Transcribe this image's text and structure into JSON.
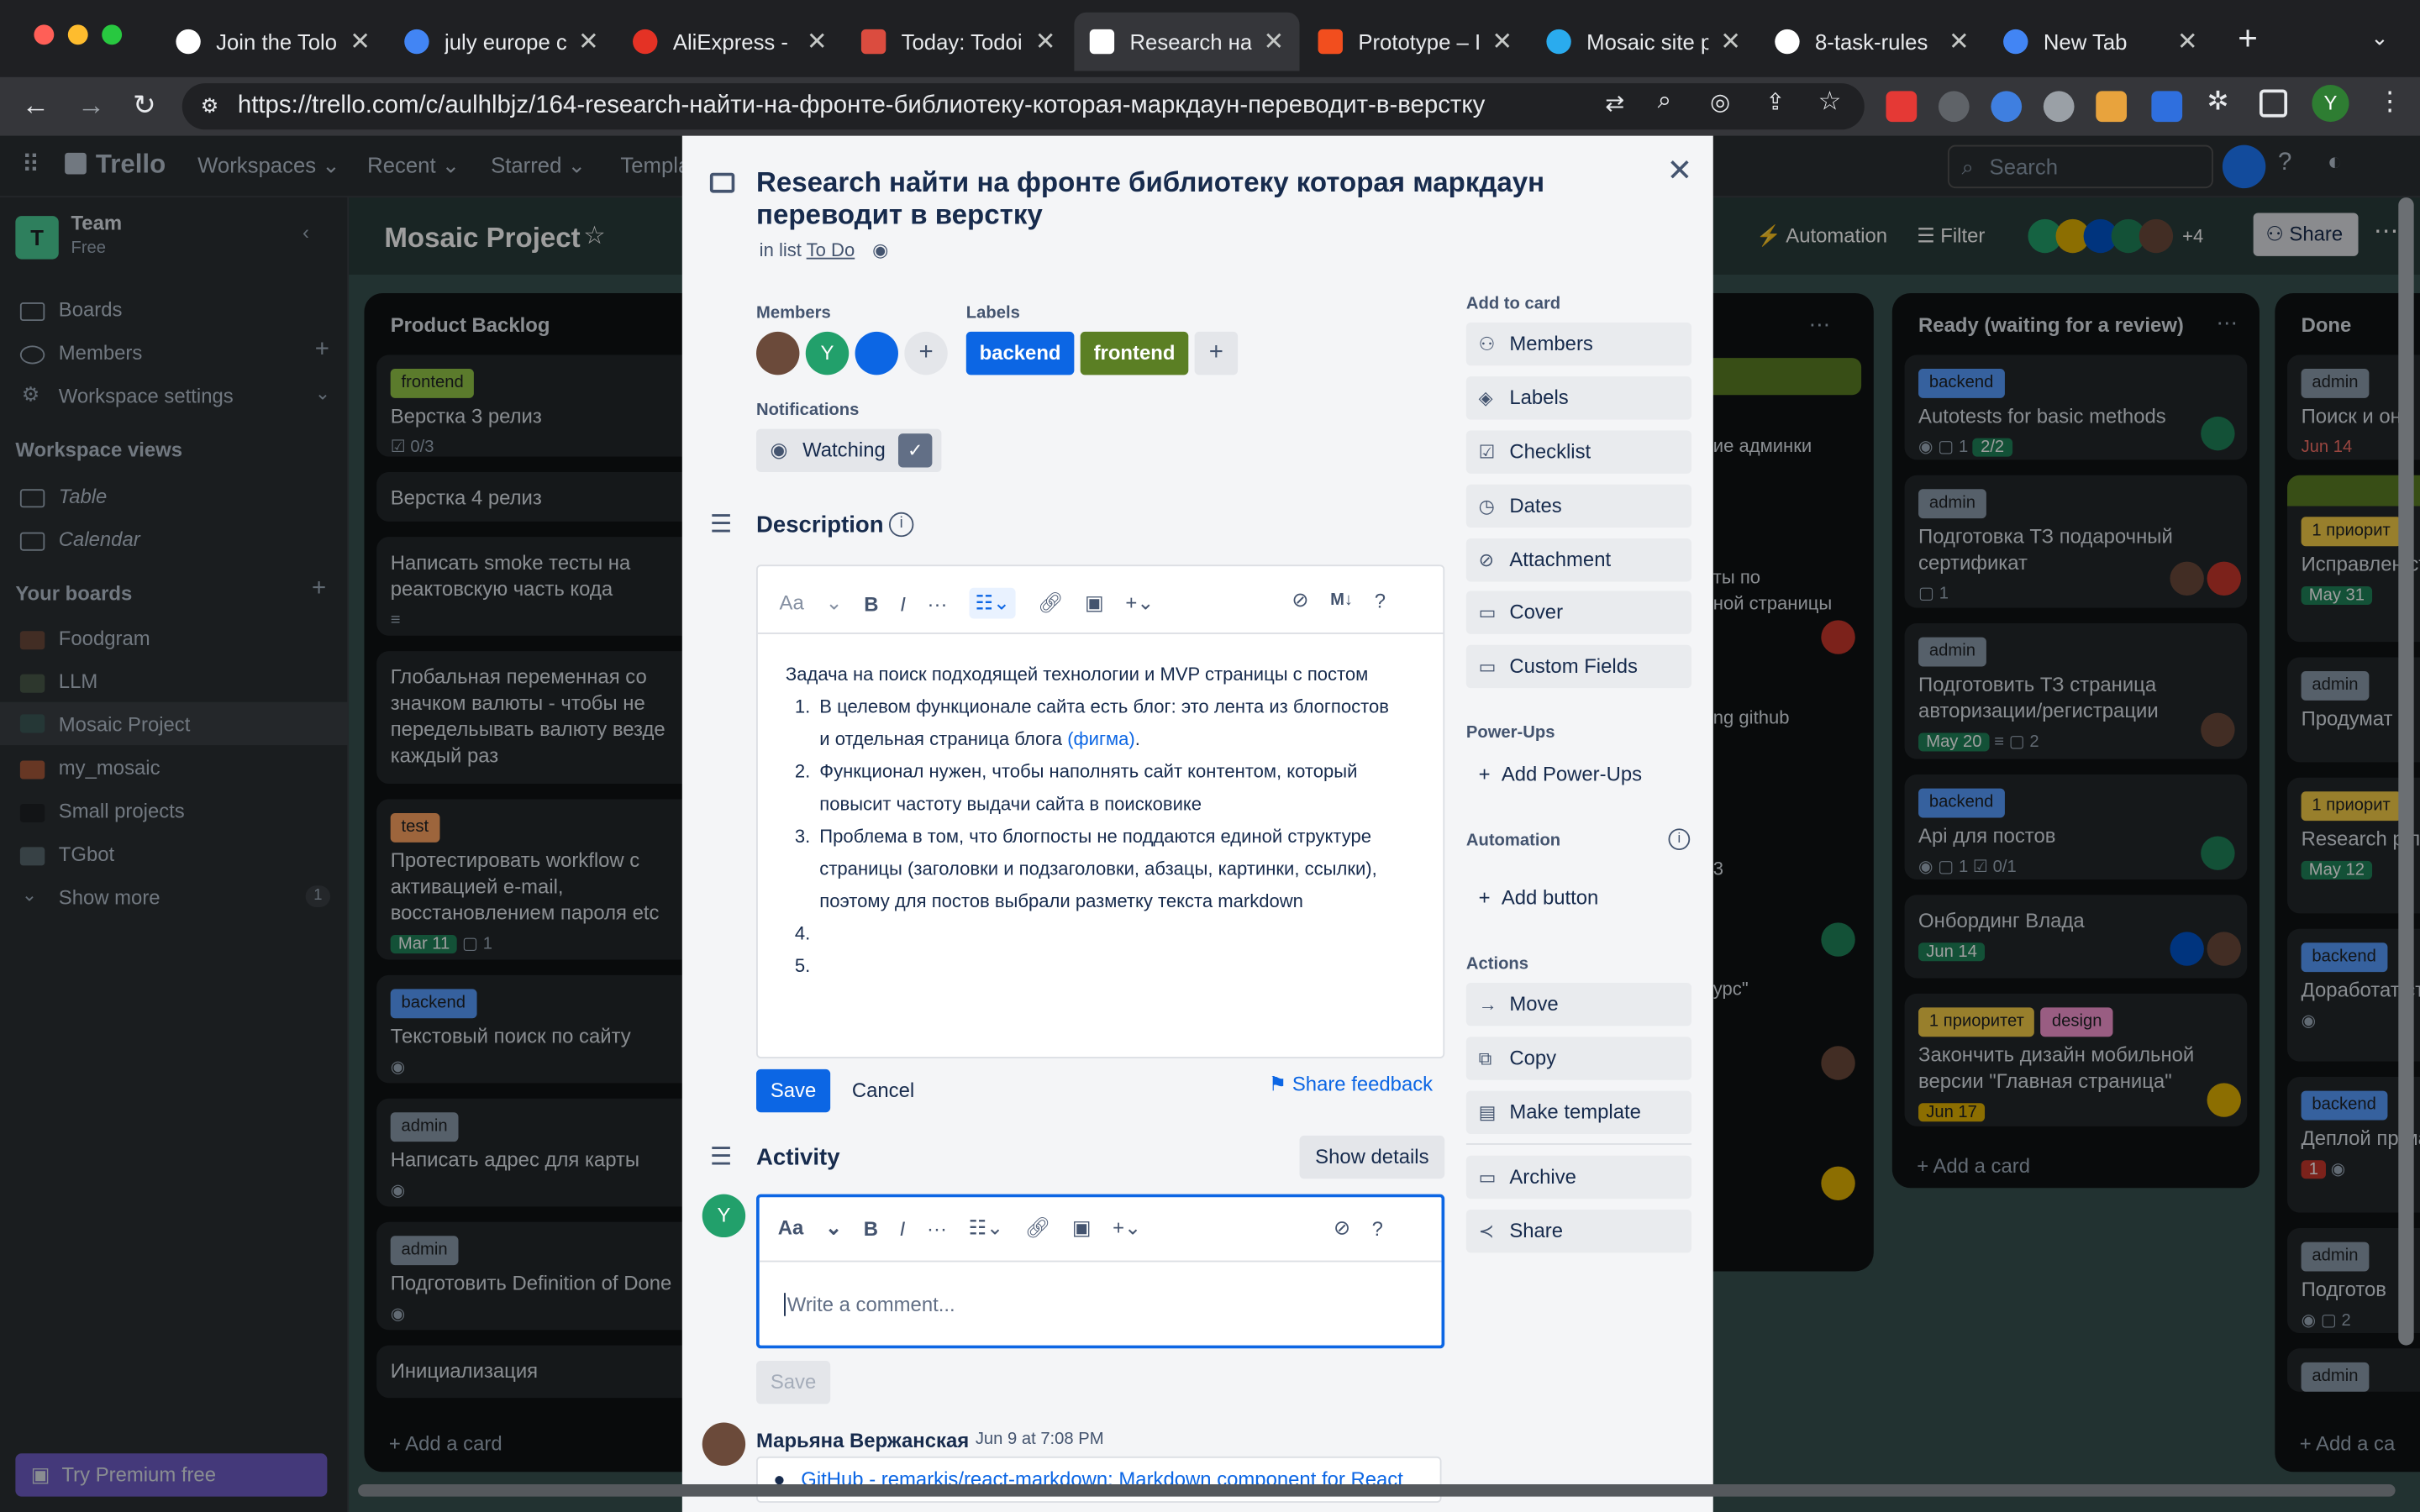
{
  "browser": {
    "tabs": [
      {
        "title": "Join the Tolo",
        "color": "#ffffff"
      },
      {
        "title": "july europe c",
        "color": "#4285f4"
      },
      {
        "title": "AliExpress -",
        "color": "#e43225"
      },
      {
        "title": "Today: Todoi",
        "color": "#db4c3f"
      },
      {
        "title": "Research на",
        "color": "#ffffff"
      },
      {
        "title": "Prototype – I",
        "color": "#f24e1e"
      },
      {
        "title": "Mosaic site p",
        "color": "#2aabee"
      },
      {
        "title": "8-task-rules",
        "color": "#ffffff"
      },
      {
        "title": "New Tab",
        "color": "#4285f4"
      }
    ],
    "url": "https://trello.com/c/aulhlbjz/164-research-найти-на-фронте-библиотеку-которая-маркдаун-переводит-в-верстку",
    "profile_initial": "Y"
  },
  "header": {
    "logo": "Trello",
    "workspaces": "Workspaces",
    "recent": "Recent",
    "starred": "Starred",
    "templates": "Templa",
    "search_placeholder": "Search"
  },
  "sidebar": {
    "team_name": "Team",
    "team_plan": "Free",
    "team_initial": "T",
    "boards": "Boards",
    "members": "Members",
    "workspace_settings": "Workspace settings",
    "views_title": "Workspace views",
    "table": "Table",
    "calendar": "Calendar",
    "your_boards": "Your boards",
    "board_items": [
      "Foodgram",
      "LLM",
      "Mosaic Project",
      "my_mosaic",
      "Small projects",
      "TGbot"
    ],
    "show_more": "Show more",
    "show_more_count": "1",
    "premium": "Try Premium free"
  },
  "board": {
    "title": "Mosaic Project",
    "automation": "Automation",
    "filter": "Filter",
    "share": "Share",
    "member_extra": "+4",
    "lists": {
      "backlog": {
        "title": "Product Backlog",
        "cards": [
          {
            "label": "frontend",
            "text": "Верстка 3 релиз",
            "badge": "0/3"
          },
          {
            "text": "Верстка 4 релиз"
          },
          {
            "text": "Написать smoke тесты на реактовскую часть кода"
          },
          {
            "text": "Глобальная переменная со значком валюты - чтобы не передельывать валюту везде каждый раз"
          },
          {
            "label": "test",
            "text": "Протестировать workflow с активацией e-mail, восстановлением пароля etc",
            "badge": "Mar 11",
            "comments": "1"
          },
          {
            "label": "backend",
            "text": "Текстовый поиск по сайту"
          },
          {
            "label": "admin",
            "text": "Написать адрес для карты"
          },
          {
            "label": "admin",
            "text": "Подготовить Definition of Done"
          },
          {
            "text": "Инициализация"
          }
        ],
        "add": "Add a card"
      },
      "ready": {
        "title": "Ready (waiting for a review)",
        "cards": [
          {
            "label": "backend",
            "text": "Autotests for basic methods",
            "comments": "1",
            "badge": "2/2"
          },
          {
            "label": "admin",
            "text": "Подготовка ТЗ подарочный сертификат",
            "comments": "1"
          },
          {
            "label": "admin",
            "text": "Подготовить ТЗ страница авторизации/регистрации",
            "badge": "May 20",
            "comments": "2"
          },
          {
            "label": "backend",
            "text": "Api для постов",
            "comments": "1",
            "badge": "0/1"
          },
          {
            "text": "Онбординг Влада",
            "badge": "Jun 14"
          },
          {
            "label": "1 приоритет",
            "label2": "design",
            "text": "Закончить дизайн мобильной версии \"Главная страница\"",
            "badge": "Jun 17"
          }
        ],
        "add": "Add a card"
      },
      "done": {
        "title": "Done",
        "cards": [
          {
            "label": "admin",
            "text": "Поиск и он",
            "badge": "Jun 14"
          },
          {
            "label": "1 приорит",
            "text": "Исправлен странице",
            "badge": "May 31"
          },
          {
            "label": "admin",
            "text": "Продумат"
          },
          {
            "label": "1 приорит",
            "text": "Research р подарочн",
            "badge": "May 12"
          },
          {
            "label": "backend",
            "text": "Доработат страницы,"
          },
          {
            "label": "backend",
            "text": "Деплой пр машину",
            "badge": "1"
          },
          {
            "label": "admin",
            "text": "Подготов",
            "comments": "2"
          },
          {
            "label": "admin",
            "text": ""
          }
        ],
        "add": "Add a ca"
      },
      "middle_fragments": [
        "ие админки",
        "ты по",
        "ной страницы",
        "ng github",
        "3",
        "урс\""
      ]
    }
  },
  "card_modal": {
    "title": "Research найти на фронте библиотеку которая маркдаун переводит в верстку",
    "in_list_prefix": "in list",
    "list_name": "To Do",
    "members_label": "Members",
    "member_initial": "Y",
    "labels_label": "Labels",
    "labels": [
      {
        "name": "backend",
        "color": "#0c66e4"
      },
      {
        "name": "frontend",
        "color": "#5b7f24"
      }
    ],
    "notifications_label": "Notifications",
    "watching": "Watching",
    "description_title": "Description",
    "description_intro": "Задача на поиск подходящей технологии и MVP страницы с постом",
    "description_items": [
      "В целевом функционале сайта есть блог: это лента из блогпостов",
      "и отдельная страница блога",
      "(фигма)",
      "Функционал нужен, чтобы наполнять сайт контентом, который",
      "повысит частоту выдачи сайта в поисковике",
      "Проблема в том, что блогпосты не поддаются единой структуре",
      "страницы (заголовки и подзаголовки, абзацы, картинки, ссылки),",
      "поэтому для постов выбрали разметку текста markdown"
    ],
    "list_numbers": [
      "1.",
      "2.",
      "3.",
      "4.",
      "5."
    ],
    "save": "Save",
    "cancel": "Cancel",
    "share_feedback": "Share feedback",
    "activity_title": "Activity",
    "show_details": "Show details",
    "comment_placeholder": "Write a comment...",
    "comment_save": "Save",
    "comment_author": "Марьяна Вержанская",
    "comment_time": "Jun 9 at 7:08 PM",
    "comment_link": "GitHub - remarkjs/react-markdown: Markdown component for React",
    "toolbar_font": "Aa"
  },
  "card_sidebar": {
    "add_to_card": "Add to card",
    "add_items": [
      "Members",
      "Labels",
      "Checklist",
      "Dates",
      "Attachment",
      "Cover",
      "Custom Fields"
    ],
    "powerups_title": "Power-Ups",
    "add_powerups": "Add Power-Ups",
    "automation_title": "Automation",
    "add_button": "Add button",
    "actions_title": "Actions",
    "actions": [
      "Move",
      "Copy",
      "Make template",
      "Archive",
      "Share"
    ]
  }
}
